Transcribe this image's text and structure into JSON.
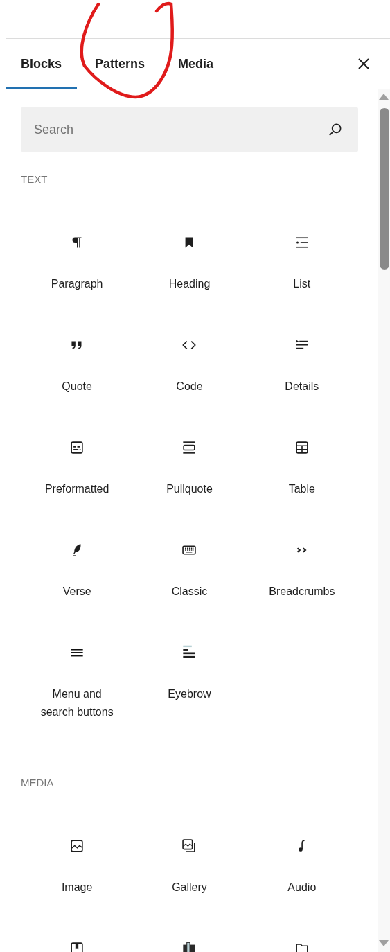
{
  "tabs": [
    {
      "label": "Blocks",
      "selected": true
    },
    {
      "label": "Patterns",
      "selected": false
    },
    {
      "label": "Media",
      "selected": false
    }
  ],
  "search": {
    "placeholder": "Search"
  },
  "categories": [
    {
      "title": "TEXT",
      "blocks": [
        {
          "kind": "paragraph",
          "label": "Paragraph"
        },
        {
          "kind": "heading",
          "label": "Heading"
        },
        {
          "kind": "list",
          "label": "List"
        },
        {
          "kind": "quote",
          "label": "Quote"
        },
        {
          "kind": "code",
          "label": "Code"
        },
        {
          "kind": "details",
          "label": "Details"
        },
        {
          "kind": "preformatted",
          "label": "Preformatted"
        },
        {
          "kind": "pullquote",
          "label": "Pullquote"
        },
        {
          "kind": "table",
          "label": "Table"
        },
        {
          "kind": "verse",
          "label": "Verse"
        },
        {
          "kind": "classic",
          "label": "Classic"
        },
        {
          "kind": "breadcrumbs",
          "label": "Breadcrumbs"
        },
        {
          "kind": "menu",
          "label": "Menu and search buttons"
        },
        {
          "kind": "eyebrow",
          "label": "Eyebrow"
        }
      ]
    },
    {
      "title": "MEDIA",
      "blocks": [
        {
          "kind": "image",
          "label": "Image"
        },
        {
          "kind": "gallery",
          "label": "Gallery"
        },
        {
          "kind": "audio",
          "label": "Audio"
        },
        {
          "kind": "cover"
        },
        {
          "kind": "media-text"
        },
        {
          "kind": "file"
        }
      ]
    }
  ],
  "annotation": {
    "kind": "freehand-circle"
  }
}
